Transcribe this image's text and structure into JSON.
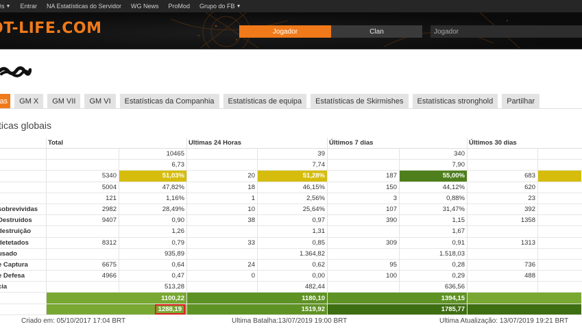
{
  "nav": {
    "items": [
      "ês",
      "Entrar",
      "NA Estatísticas do Servidor",
      "WG News",
      "ProMod",
      "Grupo do FB"
    ]
  },
  "banner": {
    "logo": "OT-LIFE.COM",
    "jogador_button": "Jogador",
    "clan_button": "Clan",
    "search_placeholder": "Jogador"
  },
  "tabs": [
    "cas",
    "GM X",
    "GM VII",
    "GM VI",
    "Estatísticas da Companhia",
    "Estatísticas de equipa",
    "Estatísticas de Skirmishes",
    "Estatísticas stronghold",
    "Partilhar"
  ],
  "section_title": "ticas globais",
  "table": {
    "headers": [
      "",
      "Total",
      "Ultimas 24 Horas",
      "Últimos 7 dias",
      "Últimos 30 dias"
    ],
    "rows": [
      {
        "label": "",
        "cells": [
          "",
          "10465",
          "",
          "39",
          "",
          "340",
          "",
          ""
        ]
      },
      {
        "label": "",
        "cells": [
          "",
          "6,73",
          "",
          "7,74",
          "",
          "7,90",
          "",
          ""
        ]
      },
      {
        "label": "",
        "cells": [
          "5340",
          "51,03%",
          "20",
          "51,28%",
          "187",
          "55,00%",
          "683",
          ""
        ]
      },
      {
        "label": "",
        "cells": [
          "5004",
          "47,82%",
          "18",
          "46,15%",
          "150",
          "44,12%",
          "620",
          ""
        ]
      },
      {
        "label": "",
        "cells": [
          "121",
          "1,16%",
          "1",
          "2,56%",
          "3",
          "0,88%",
          "23",
          ""
        ]
      },
      {
        "label": "sobrevividas",
        "cells": [
          "2982",
          "28,49%",
          "10",
          "25,64%",
          "107",
          "31,47%",
          "392",
          ""
        ]
      },
      {
        "label": "Destruídos",
        "cells": [
          "9407",
          "0,90",
          "38",
          "0,97",
          "390",
          "1,15",
          "1358",
          ""
        ]
      },
      {
        "label": "destruição",
        "cells": [
          "",
          "1,26",
          "",
          "1,31",
          "",
          "1,67",
          "",
          ""
        ]
      },
      {
        "label": "detetados",
        "cells": [
          "8312",
          "0,79",
          "33",
          "0,85",
          "309",
          "0,91",
          "1313",
          ""
        ]
      },
      {
        "label": "usado",
        "cells": [
          "",
          "935,89",
          "",
          "1.364,82",
          "",
          "1.518,03",
          "",
          ""
        ]
      },
      {
        "label": "e Captura",
        "cells": [
          "6675",
          "0,64",
          "24",
          "0,62",
          "95",
          "0,28",
          "736",
          ""
        ]
      },
      {
        "label": "e Defesa",
        "cells": [
          "4966",
          "0,47",
          "0",
          "0,00",
          "100",
          "0,29",
          "488",
          ""
        ]
      },
      {
        "label": "cia",
        "cells": [
          "",
          "513,28",
          "",
          "482,44",
          "",
          "636,56",
          "",
          ""
        ]
      },
      {
        "label": "",
        "cells": [
          "",
          "1100,22",
          "",
          "1180,10",
          "",
          "1394,15",
          "",
          ""
        ]
      },
      {
        "label": "",
        "cells": [
          "",
          "1288,19",
          "",
          "1519,92",
          "",
          "1785,77",
          "",
          ""
        ]
      }
    ]
  },
  "footer": {
    "created": "Criado em: 05/10/2017 17:04 BRT",
    "last_battle": "Ultima Batalha:13/07/2019 19:00 BRT",
    "last_update": "Ultima Atualização: 13/07/2019 19:21 BRT"
  },
  "colors": {
    "accent": "#f07a1a",
    "yellow": "#d6bd0d",
    "green": "#4f7f1c",
    "highlight_box": "#e02020"
  }
}
